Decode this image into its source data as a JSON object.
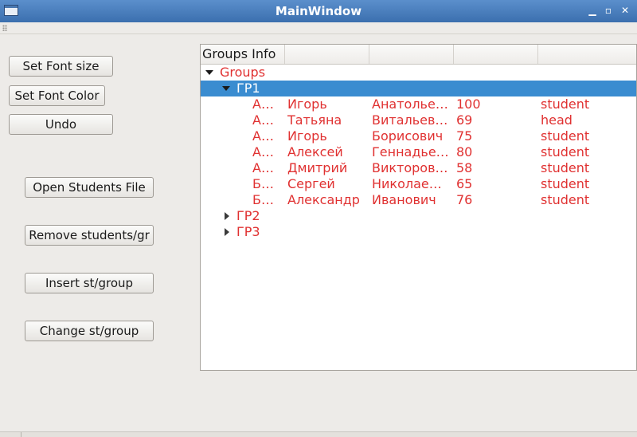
{
  "window": {
    "title": "MainWindow"
  },
  "buttons": {
    "set_font_size": "Set Font size",
    "set_font_color": "Set Font Color",
    "undo": "Undo",
    "open_students_file": "Open Students File",
    "remove_students": "Remove students/gr",
    "insert": "Insert st/group",
    "change": "Change st/group"
  },
  "tree": {
    "headers": [
      "Groups Info",
      "",
      "",
      "",
      ""
    ],
    "root": "Groups",
    "groups": [
      {
        "name": "ГР1",
        "expanded": true,
        "selected": true,
        "students": [
          {
            "c0": "А…",
            "c1": "Игорь",
            "c2": "Анатолье…",
            "c3": "100",
            "c4": "student"
          },
          {
            "c0": "А…",
            "c1": "Татьяна",
            "c2": "Витальев…",
            "c3": "69",
            "c4": "head"
          },
          {
            "c0": "А…",
            "c1": "Игорь",
            "c2": "Борисович",
            "c3": "75",
            "c4": "student"
          },
          {
            "c0": "А…",
            "c1": "Алексей",
            "c2": "Геннадье…",
            "c3": "80",
            "c4": "student"
          },
          {
            "c0": "А…",
            "c1": "Дмитрий",
            "c2": "Викторов…",
            "c3": "58",
            "c4": "student"
          },
          {
            "c0": "Б…",
            "c1": "Сергей",
            "c2": "Николае…",
            "c3": "65",
            "c4": "student"
          },
          {
            "c0": "Б…",
            "c1": "Александр",
            "c2": "Иванович",
            "c3": "76",
            "c4": "student"
          }
        ]
      },
      {
        "name": "ГР2",
        "expanded": false,
        "selected": false,
        "students": []
      },
      {
        "name": "ГР3",
        "expanded": false,
        "selected": false,
        "students": []
      }
    ]
  },
  "colors": {
    "text_red": "#e03131",
    "selection": "#3a8cd0"
  }
}
